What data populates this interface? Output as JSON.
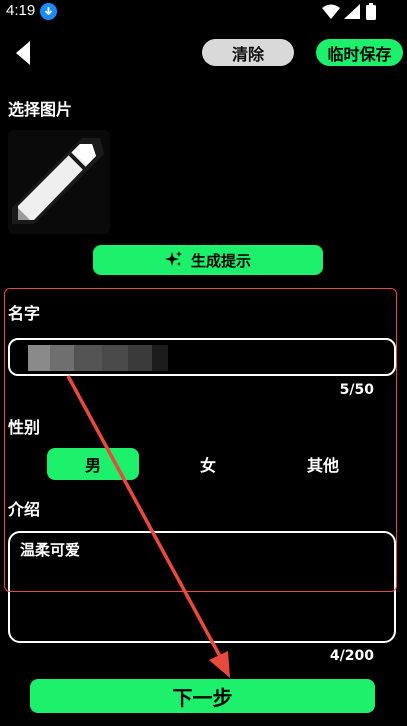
{
  "status_bar": {
    "time": "4:19"
  },
  "header": {
    "clear_label": "清除",
    "save_draft_label": "临时保存"
  },
  "image_section": {
    "label": "选择图片"
  },
  "generate_prompt": {
    "label": "生成提示"
  },
  "name_section": {
    "label": "名字",
    "counter": "5/50"
  },
  "gender_section": {
    "label": "性别",
    "options": [
      "男",
      "女",
      "其他"
    ],
    "selected": "男"
  },
  "intro_section": {
    "label": "介绍",
    "value": "温柔可爱",
    "counter": "4/200"
  },
  "footer": {
    "next_label": "下一步"
  },
  "colors": {
    "accent": "#1df06a",
    "annotation": "#e84a3c",
    "background": "#000000"
  }
}
